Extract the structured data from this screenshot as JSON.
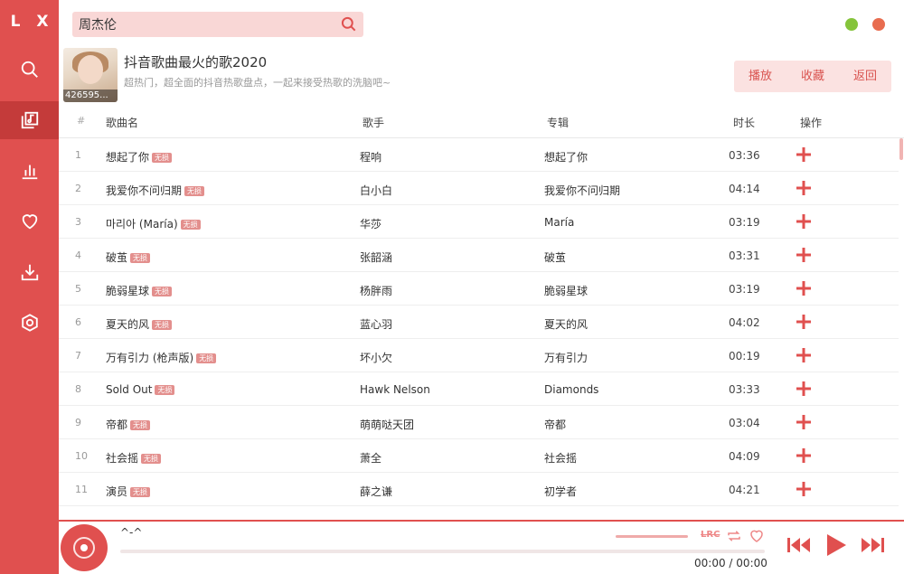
{
  "app": {
    "logo": "L X"
  },
  "sidebar": {
    "items": [
      {
        "icon": "search-icon",
        "active": false
      },
      {
        "icon": "music-library-icon",
        "active": true
      },
      {
        "icon": "leaderboard-icon",
        "active": false
      },
      {
        "icon": "heart-icon",
        "active": false
      },
      {
        "icon": "download-icon",
        "active": false
      },
      {
        "icon": "settings-icon",
        "active": false
      }
    ]
  },
  "search": {
    "value": "周杰伦"
  },
  "playlist": {
    "play_count": "426595...",
    "title": "抖音歌曲最火的歌2020",
    "description": "超热门，超全面的抖音热歌盘点，一起来接受热歌的洗脑吧~",
    "actions": {
      "play": "播放",
      "collect": "收藏",
      "back": "返回"
    }
  },
  "table": {
    "headers": {
      "index": "#",
      "name": "歌曲名",
      "singer": "歌手",
      "album": "专辑",
      "duration": "时长",
      "action": "操作"
    },
    "tag_label": "无损",
    "rows": [
      {
        "index": "1",
        "name": "想起了你",
        "singer": "程响",
        "album": "想起了你",
        "duration": "03:36"
      },
      {
        "index": "2",
        "name": "我爱你不问归期",
        "singer": "白小白",
        "album": "我爱你不问归期",
        "duration": "04:14"
      },
      {
        "index": "3",
        "name": "마리아 (María)",
        "singer": "华莎",
        "album": "María",
        "duration": "03:19"
      },
      {
        "index": "4",
        "name": "破茧",
        "singer": "张韶涵",
        "album": "破茧",
        "duration": "03:31"
      },
      {
        "index": "5",
        "name": "脆弱星球",
        "singer": "杨胖雨",
        "album": "脆弱星球",
        "duration": "03:19"
      },
      {
        "index": "6",
        "name": "夏天的风",
        "singer": "蓝心羽",
        "album": "夏天的风",
        "duration": "04:02"
      },
      {
        "index": "7",
        "name": "万有引力 (枪声版)",
        "singer": "坏小欠",
        "album": "万有引力",
        "duration": "00:19"
      },
      {
        "index": "8",
        "name": "Sold Out",
        "singer": "Hawk Nelson",
        "album": "Diamonds",
        "duration": "03:33"
      },
      {
        "index": "9",
        "name": "帝都",
        "singer": "萌萌哒天团",
        "album": "帝都",
        "duration": "03:04"
      },
      {
        "index": "10",
        "name": "社会摇",
        "singer": "萧全",
        "album": "社会摇",
        "duration": "04:09"
      },
      {
        "index": "11",
        "name": "演员",
        "singer": "薛之谦",
        "album": "初学者",
        "duration": "04:21"
      }
    ]
  },
  "player": {
    "title": "^-^",
    "current_time": "00:00",
    "separator": "/",
    "total_time": "00:00",
    "progress": 0,
    "lrc_label": "LRC"
  },
  "colors": {
    "accent": "#e0504f",
    "accent_dark": "#c43b3a",
    "accent_light": "#fbe2e1"
  }
}
